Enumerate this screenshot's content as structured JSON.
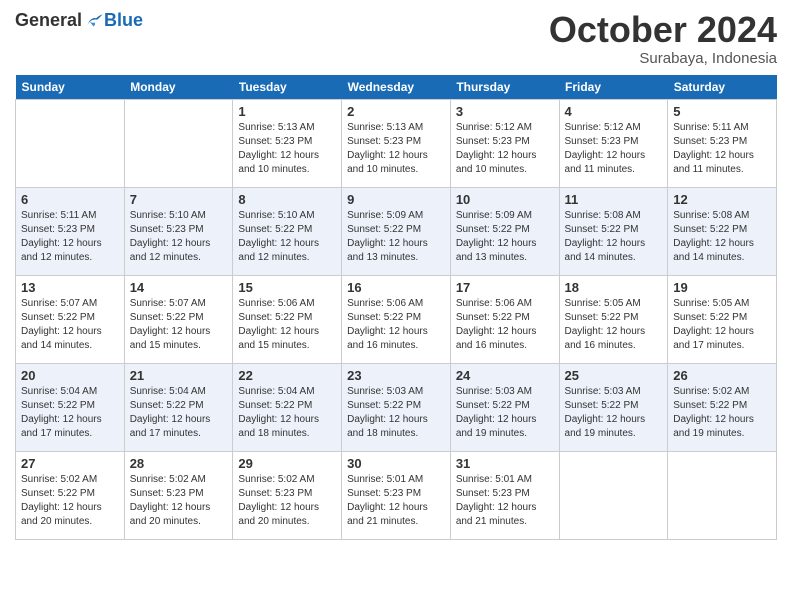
{
  "header": {
    "logo_general": "General",
    "logo_blue": "Blue",
    "month_title": "October 2024",
    "subtitle": "Surabaya, Indonesia"
  },
  "days_of_week": [
    "Sunday",
    "Monday",
    "Tuesday",
    "Wednesday",
    "Thursday",
    "Friday",
    "Saturday"
  ],
  "weeks": [
    [
      {
        "day": "",
        "info": ""
      },
      {
        "day": "",
        "info": ""
      },
      {
        "day": "1",
        "info": "Sunrise: 5:13 AM\nSunset: 5:23 PM\nDaylight: 12 hours\nand 10 minutes."
      },
      {
        "day": "2",
        "info": "Sunrise: 5:13 AM\nSunset: 5:23 PM\nDaylight: 12 hours\nand 10 minutes."
      },
      {
        "day": "3",
        "info": "Sunrise: 5:12 AM\nSunset: 5:23 PM\nDaylight: 12 hours\nand 10 minutes."
      },
      {
        "day": "4",
        "info": "Sunrise: 5:12 AM\nSunset: 5:23 PM\nDaylight: 12 hours\nand 11 minutes."
      },
      {
        "day": "5",
        "info": "Sunrise: 5:11 AM\nSunset: 5:23 PM\nDaylight: 12 hours\nand 11 minutes."
      }
    ],
    [
      {
        "day": "6",
        "info": "Sunrise: 5:11 AM\nSunset: 5:23 PM\nDaylight: 12 hours\nand 12 minutes."
      },
      {
        "day": "7",
        "info": "Sunrise: 5:10 AM\nSunset: 5:23 PM\nDaylight: 12 hours\nand 12 minutes."
      },
      {
        "day": "8",
        "info": "Sunrise: 5:10 AM\nSunset: 5:22 PM\nDaylight: 12 hours\nand 12 minutes."
      },
      {
        "day": "9",
        "info": "Sunrise: 5:09 AM\nSunset: 5:22 PM\nDaylight: 12 hours\nand 13 minutes."
      },
      {
        "day": "10",
        "info": "Sunrise: 5:09 AM\nSunset: 5:22 PM\nDaylight: 12 hours\nand 13 minutes."
      },
      {
        "day": "11",
        "info": "Sunrise: 5:08 AM\nSunset: 5:22 PM\nDaylight: 12 hours\nand 14 minutes."
      },
      {
        "day": "12",
        "info": "Sunrise: 5:08 AM\nSunset: 5:22 PM\nDaylight: 12 hours\nand 14 minutes."
      }
    ],
    [
      {
        "day": "13",
        "info": "Sunrise: 5:07 AM\nSunset: 5:22 PM\nDaylight: 12 hours\nand 14 minutes."
      },
      {
        "day": "14",
        "info": "Sunrise: 5:07 AM\nSunset: 5:22 PM\nDaylight: 12 hours\nand 15 minutes."
      },
      {
        "day": "15",
        "info": "Sunrise: 5:06 AM\nSunset: 5:22 PM\nDaylight: 12 hours\nand 15 minutes."
      },
      {
        "day": "16",
        "info": "Sunrise: 5:06 AM\nSunset: 5:22 PM\nDaylight: 12 hours\nand 16 minutes."
      },
      {
        "day": "17",
        "info": "Sunrise: 5:06 AM\nSunset: 5:22 PM\nDaylight: 12 hours\nand 16 minutes."
      },
      {
        "day": "18",
        "info": "Sunrise: 5:05 AM\nSunset: 5:22 PM\nDaylight: 12 hours\nand 16 minutes."
      },
      {
        "day": "19",
        "info": "Sunrise: 5:05 AM\nSunset: 5:22 PM\nDaylight: 12 hours\nand 17 minutes."
      }
    ],
    [
      {
        "day": "20",
        "info": "Sunrise: 5:04 AM\nSunset: 5:22 PM\nDaylight: 12 hours\nand 17 minutes."
      },
      {
        "day": "21",
        "info": "Sunrise: 5:04 AM\nSunset: 5:22 PM\nDaylight: 12 hours\nand 17 minutes."
      },
      {
        "day": "22",
        "info": "Sunrise: 5:04 AM\nSunset: 5:22 PM\nDaylight: 12 hours\nand 18 minutes."
      },
      {
        "day": "23",
        "info": "Sunrise: 5:03 AM\nSunset: 5:22 PM\nDaylight: 12 hours\nand 18 minutes."
      },
      {
        "day": "24",
        "info": "Sunrise: 5:03 AM\nSunset: 5:22 PM\nDaylight: 12 hours\nand 19 minutes."
      },
      {
        "day": "25",
        "info": "Sunrise: 5:03 AM\nSunset: 5:22 PM\nDaylight: 12 hours\nand 19 minutes."
      },
      {
        "day": "26",
        "info": "Sunrise: 5:02 AM\nSunset: 5:22 PM\nDaylight: 12 hours\nand 19 minutes."
      }
    ],
    [
      {
        "day": "27",
        "info": "Sunrise: 5:02 AM\nSunset: 5:22 PM\nDaylight: 12 hours\nand 20 minutes."
      },
      {
        "day": "28",
        "info": "Sunrise: 5:02 AM\nSunset: 5:23 PM\nDaylight: 12 hours\nand 20 minutes."
      },
      {
        "day": "29",
        "info": "Sunrise: 5:02 AM\nSunset: 5:23 PM\nDaylight: 12 hours\nand 20 minutes."
      },
      {
        "day": "30",
        "info": "Sunrise: 5:01 AM\nSunset: 5:23 PM\nDaylight: 12 hours\nand 21 minutes."
      },
      {
        "day": "31",
        "info": "Sunrise: 5:01 AM\nSunset: 5:23 PM\nDaylight: 12 hours\nand 21 minutes."
      },
      {
        "day": "",
        "info": ""
      },
      {
        "day": "",
        "info": ""
      }
    ]
  ]
}
